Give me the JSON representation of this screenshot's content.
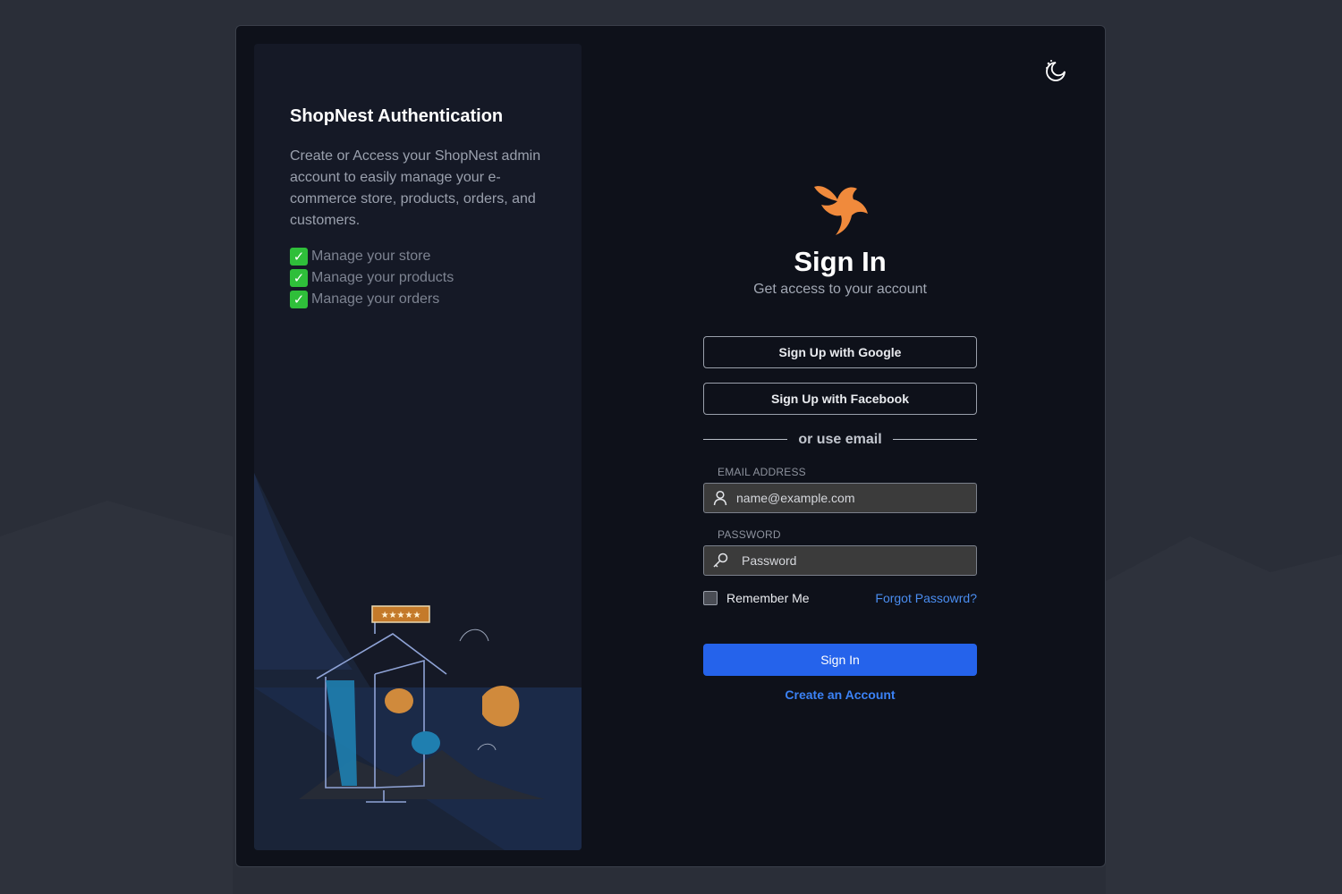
{
  "left_panel": {
    "title": "ShopNest Authentication",
    "description": "Create or Access your ShopNest admin account to easily manage your e-commerce store, products, orders, and customers.",
    "features": [
      {
        "icon": "check-icon",
        "label": "Manage your store"
      },
      {
        "icon": "check-icon",
        "label": "Manage your products"
      },
      {
        "icon": "check-icon",
        "label": "Manage your orders"
      }
    ],
    "illustration": "birdhouse-illustration",
    "illustration_sign": "★★★★★"
  },
  "header": {
    "theme_toggle_icon": "moon-stars-icon",
    "logo_icon": "phoenix-logo-icon"
  },
  "auth": {
    "title": "Sign In",
    "subtitle": "Get access to your account",
    "google_button": "Sign Up with Google",
    "facebook_button": "Sign Up with Facebook",
    "divider_text": "or use email",
    "email_label": "EMAIL ADDRESS",
    "email_placeholder": "name@example.com",
    "email_icon": "user-icon",
    "password_label": "PASSWORD",
    "password_placeholder": "Password",
    "password_icon": "key-icon",
    "remember_label": "Remember Me",
    "remember_checked": false,
    "forgot_link": "Forgot Passowrd?",
    "signin_button": "Sign In",
    "create_link": "Create an Account"
  },
  "colors": {
    "accent": "#2563eb",
    "link": "#3b82f6",
    "logo": "#f08a3c",
    "check": "#2fbf3a"
  }
}
